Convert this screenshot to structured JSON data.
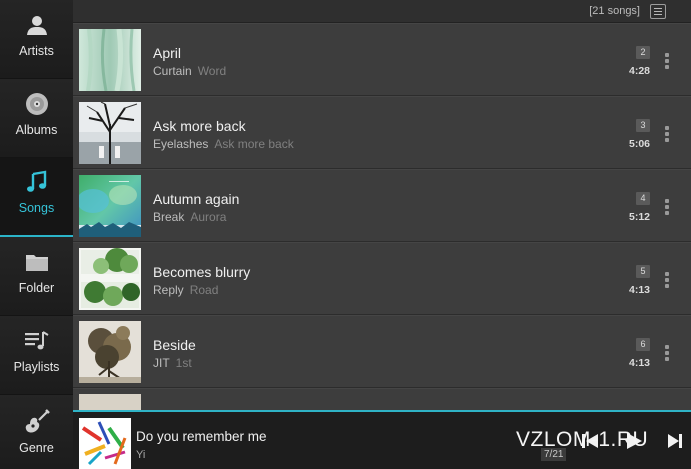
{
  "sidebar": {
    "items": [
      {
        "label": "Artists",
        "icon": "person-icon",
        "active": false
      },
      {
        "label": "Albums",
        "icon": "disc-icon",
        "active": false
      },
      {
        "label": "Songs",
        "icon": "music-note-icon",
        "active": true
      },
      {
        "label": "Folder",
        "icon": "folder-icon",
        "active": false
      },
      {
        "label": "Playlists",
        "icon": "playlist-icon",
        "active": false
      },
      {
        "label": "Genre",
        "icon": "guitar-icon",
        "active": false
      }
    ]
  },
  "header": {
    "song_count": "[21 songs]"
  },
  "songs": [
    {
      "title": "April",
      "artist": "Curtain",
      "album": "Word",
      "track": "2",
      "duration": "4:28"
    },
    {
      "title": "Ask more back",
      "artist": "Eyelashes",
      "album": "Ask more back",
      "track": "3",
      "duration": "5:06"
    },
    {
      "title": "Autumn again",
      "artist": "Break",
      "album": "Aurora",
      "track": "4",
      "duration": "5:12"
    },
    {
      "title": "Becomes blurry",
      "artist": "Reply",
      "album": "Road",
      "track": "5",
      "duration": "4:13"
    },
    {
      "title": "Beside",
      "artist": "JIT",
      "album": "1st",
      "track": "6",
      "duration": "4:13"
    }
  ],
  "now_playing": {
    "title": "Do you remember me",
    "artist": "Yi",
    "position": "7/21"
  },
  "watermark": "VZLOM-1.RU",
  "colors": {
    "accent": "#2fb3c6",
    "active_label": "#35c3d8"
  }
}
